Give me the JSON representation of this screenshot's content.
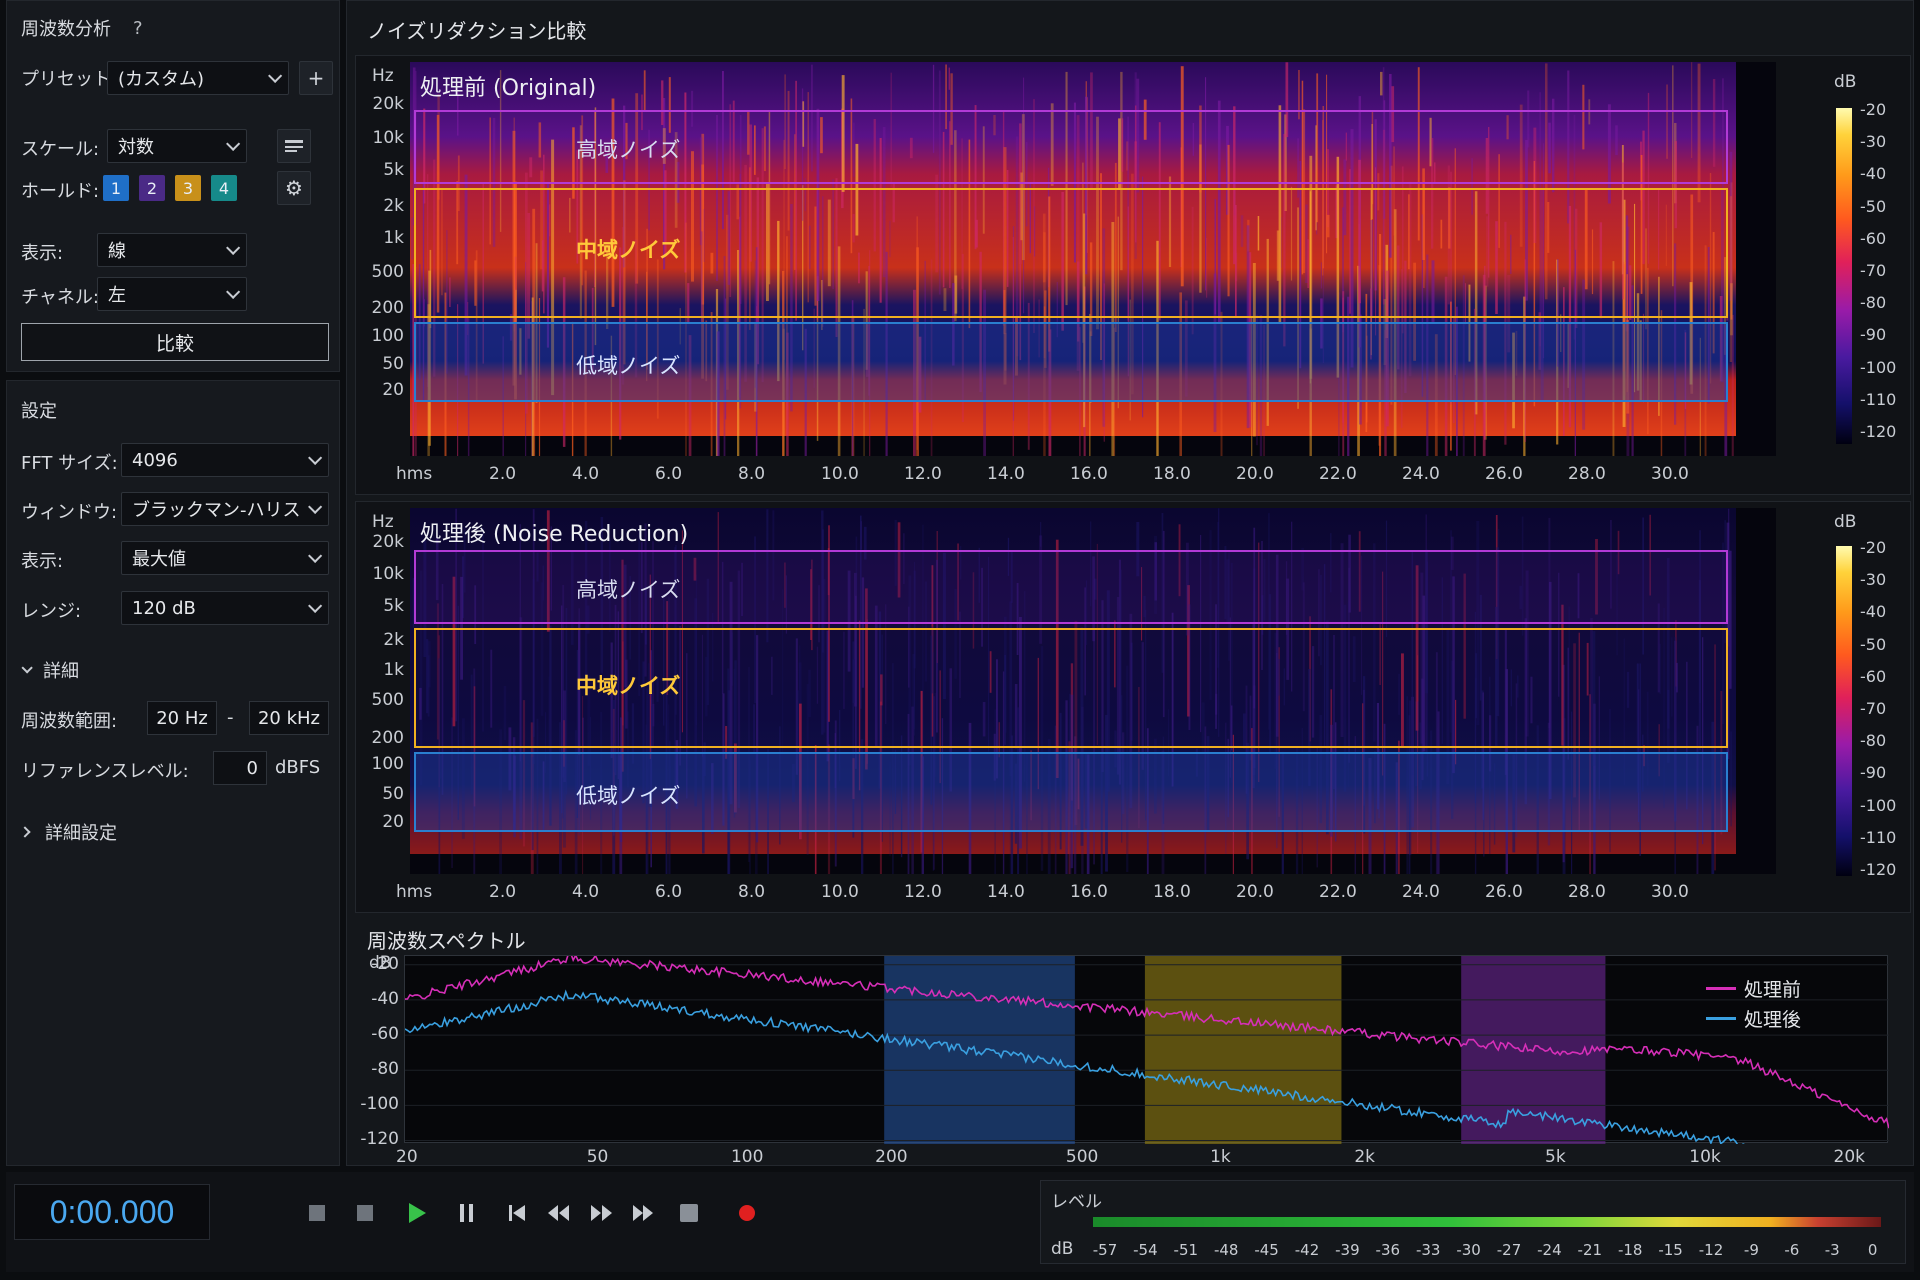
{
  "left_panel": {
    "title": "周波数分析",
    "help": "?",
    "preset_label": "プリセット:",
    "preset_value": "(カスタム)",
    "scale_label": "スケール:",
    "scale_value": "対数",
    "hold_label": "ホールド:",
    "holds": [
      "1",
      "2",
      "3",
      "4"
    ],
    "display_label": "表示:",
    "display_value": "線",
    "channel_label": "チャネル:",
    "channel_value": "左",
    "compare_button": "比較",
    "settings_title": "設定",
    "fft_label": "FFT サイズ:",
    "fft_value": "4096",
    "window_label": "ウィンドウ:",
    "window_value": "ブラックマン-ハリス",
    "show_label": "表示:",
    "show_value": "最大値",
    "range_label": "レンジ:",
    "range_value": "120 dB",
    "detail_title": "詳細",
    "freq_range_label": "周波数範囲:",
    "freq_min": "20 Hz",
    "freq_sep": "-",
    "freq_max": "20 kHz",
    "ref_label": "リファレンスレベル:",
    "ref_value": "0",
    "ref_unit": "dBFS",
    "advanced": "詳細設定"
  },
  "main": {
    "title": "ノイズリダクション比較",
    "freq_unit": "Hz",
    "time_unit": "hms",
    "db_unit": "dB",
    "freq_ticks": [
      "20k",
      "10k",
      "5k",
      "2k",
      "1k",
      "500",
      "200",
      "100",
      "50",
      "20"
    ],
    "time_ticks": [
      "2.0",
      "4.0",
      "6.0",
      "8.0",
      "10.0",
      "12.0",
      "14.0",
      "16.0",
      "18.0",
      "20.0",
      "22.0",
      "24.0",
      "26.0",
      "28.0",
      "30.0"
    ],
    "db_ticks": [
      "-20",
      "-30",
      "-40",
      "-50",
      "-60",
      "-70",
      "-80",
      "-90",
      "-100",
      "-110",
      "-120"
    ],
    "before": {
      "title": "処理前 (Original)",
      "bands": [
        "高域ノイズ",
        "中域ノイズ",
        "低域ノイズ"
      ]
    },
    "after": {
      "title": "処理後 (Noise Reduction)",
      "bands": [
        "高域ノイズ",
        "中域ノイズ",
        "低域ノイズ"
      ]
    },
    "colors": {
      "high": "#b23ad6",
      "mid": "#f0b020",
      "low": "#2a7fd0"
    }
  },
  "spectrum": {
    "title": "周波数スペクトル",
    "y_unit": "dB",
    "y_ticks": [
      "-20",
      "-40",
      "-60",
      "-80",
      "-100",
      "-120"
    ],
    "x_ticks": [
      "20",
      "50",
      "100",
      "200",
      "500",
      "1k",
      "2k",
      "5k",
      "10k",
      "20k"
    ],
    "legend_before": "処理前",
    "legend_after": "処理後",
    "color_before": "#d62fb8",
    "color_after": "#3aa0e0"
  },
  "transport": {
    "time": "0:00.000"
  },
  "level": {
    "title": "レベル",
    "unit": "dB",
    "ticks": [
      "-57",
      "-54",
      "-51",
      "-48",
      "-45",
      "-42",
      "-39",
      "-36",
      "-33",
      "-30",
      "-27",
      "-24",
      "-21",
      "-18",
      "-15",
      "-12",
      "-9",
      "-6",
      "-3",
      "0"
    ]
  }
}
